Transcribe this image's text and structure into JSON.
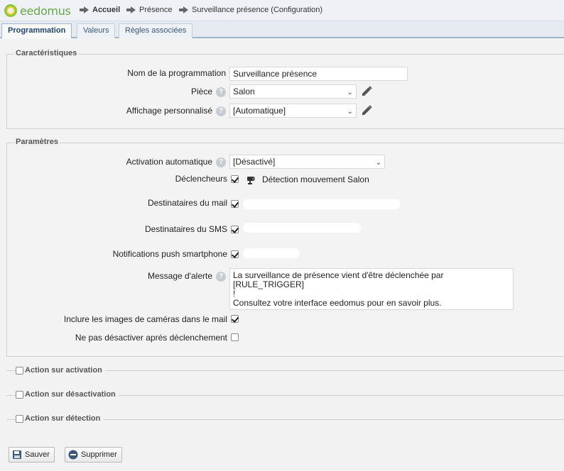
{
  "app": {
    "logo_text": "eedomus"
  },
  "breadcrumb": [
    "Accueil",
    "Présence",
    "Surveillance présence (Configuration)"
  ],
  "tabs": [
    {
      "label": "Programmation",
      "active": true
    },
    {
      "label": "Valeurs",
      "active": false
    },
    {
      "label": "Règles associées",
      "active": false
    }
  ],
  "caracteristiques": {
    "legend": "Caractéristiques",
    "nom_label": "Nom de la programmation",
    "nom_value": "Surveillance présence",
    "piece_label": "Pièce",
    "piece_value": "Salon",
    "affichage_label": "Affichage personnalisé",
    "affichage_value": "[Automatique]"
  },
  "parametres": {
    "legend": "Paramètres",
    "activation_label": "Activation automatique",
    "activation_value": "[Désactivé]",
    "declencheurs_label": "Déclencheurs",
    "declencheur_item": "Détection mouvement Salon",
    "declencheur_checked": true,
    "mail_label": "Destinataires du mail",
    "mail_checked": true,
    "sms_label": "Destinataires du SMS",
    "sms_checked": true,
    "push_label": "Notifications push smartphone",
    "push_checked": true,
    "message_label": "Message d'alerte",
    "message_line1": "La surveillance de présence vient d'être déclenchée par [RULE_TRIGGER]",
    "message_line2": "!",
    "message_line3": "Consultez votre interface eedomus pour en savoir plus.",
    "images_label": "Inclure les images de caméras dans le mail",
    "images_checked": true,
    "nodisable_label": "Ne pas désactiver aprés déclenchement",
    "nodisable_checked": false
  },
  "sections": [
    {
      "label": "Action sur activation",
      "checked": false
    },
    {
      "label": "Action sur désactivation",
      "checked": false
    },
    {
      "label": "Action sur détection",
      "checked": false
    }
  ],
  "buttons": {
    "save": "Sauver",
    "delete": "Supprimer"
  },
  "help_glyph": "?",
  "chevron_glyph": "⌄",
  "colors": {
    "logo_green": "#8cc63f",
    "tab_active_text": "#24456b",
    "delete_icon": "#3b5677"
  }
}
